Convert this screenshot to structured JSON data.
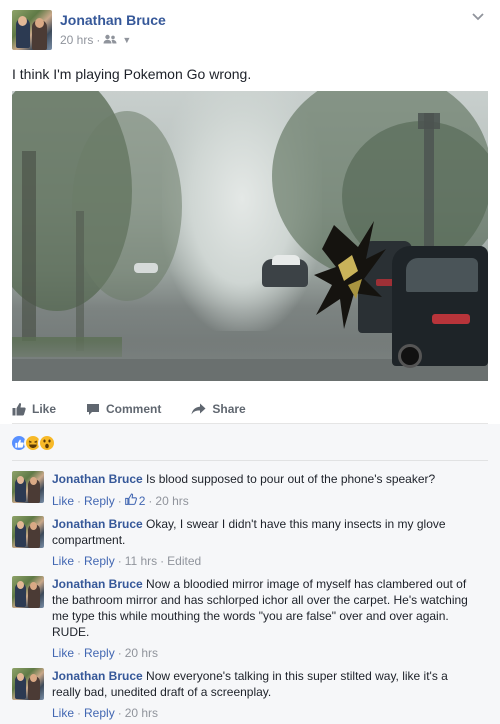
{
  "post": {
    "author": "Jonathan Bruce",
    "time": "20 hrs",
    "separator": "·",
    "text": "I think I'm playing Pokemon Go wrong."
  },
  "actions": {
    "like": "Like",
    "comment": "Comment",
    "share": "Share"
  },
  "colors": {
    "link": "#365899",
    "meta": "#90949c",
    "comments_bg": "#f6f7f9",
    "like_blue": "#5890ff"
  },
  "reactions": [
    "like-icon",
    "haha-icon",
    "wow-icon"
  ],
  "comments": [
    {
      "author": "Jonathan Bruce",
      "text": "Is blood supposed to pour out of the phone's speaker?",
      "like": "Like",
      "reply": "Reply",
      "likes": "2",
      "time": "20 hrs",
      "edited": ""
    },
    {
      "author": "Jonathan Bruce",
      "text": "Okay, I swear I didn't have this many insects in my glove compartment.",
      "like": "Like",
      "reply": "Reply",
      "likes": "",
      "time": "11 hrs",
      "edited": "Edited"
    },
    {
      "author": "Jonathan Bruce",
      "text": "Now a bloodied mirror image of myself has clambered out of the bathroom mirror and has schlorped ichor all over the carpet. He's watching me type this while mouthing the words \"you are false\" over and over again. RUDE.",
      "like": "Like",
      "reply": "Reply",
      "likes": "",
      "time": "20 hrs",
      "edited": ""
    },
    {
      "author": "Jonathan Bruce",
      "text": "Now everyone's talking in this super stilted way, like it's a really bad, unedited draft of a screenplay.",
      "like": "Like",
      "reply": "Reply",
      "likes": "",
      "time": "20 hrs",
      "edited": ""
    }
  ]
}
